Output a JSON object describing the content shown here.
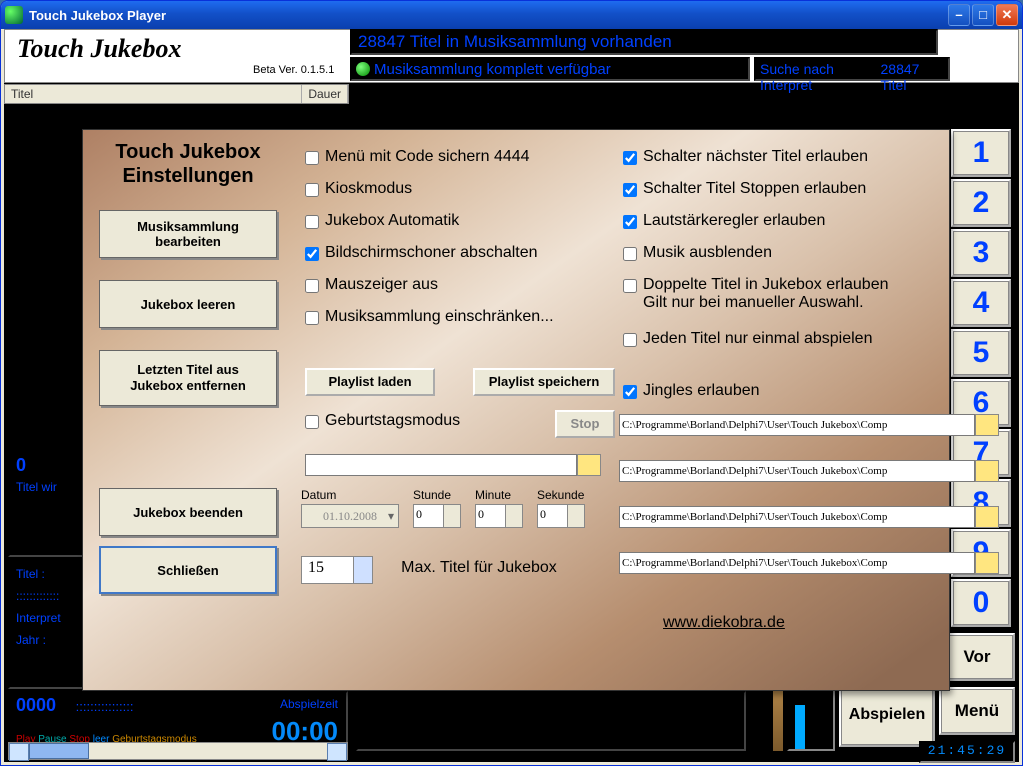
{
  "window": {
    "title": "Touch Jukebox Player"
  },
  "header": {
    "app_title": "Touch Jukebox",
    "beta": "Beta Ver. 0.1.5.1",
    "status": "28847 Titel in Musiksammlung vorhanden",
    "avail": "Musiksammlung komplett verfügbar",
    "search_label": "Suche nach Interpret",
    "search_count": "28847 Titel"
  },
  "list_header": {
    "titel": "Titel",
    "dauer": "Dauer"
  },
  "left_panels": {
    "count": "0",
    "queue": "Titel wir",
    "titel_label": "Titel :",
    "titel_dots": ":::::::::::::",
    "interpret_label": "Interpret",
    "jahr_label": "Jahr :",
    "year": "0000",
    "dots2": "::::::::::::::::",
    "play_label": "Abspielzeit",
    "play_time": "00:00",
    "tags": {
      "play": "Play",
      "pause": "Pause",
      "stop": "Stop",
      "leer": "leer",
      "gm": "Geburtstagsmodus"
    }
  },
  "keypad": [
    "1",
    "2",
    "3",
    "4",
    "5",
    "6",
    "7",
    "8",
    "9",
    "0"
  ],
  "side": {
    "vor": "Vor",
    "menu": "Menü",
    "abspielen": "Abspielen"
  },
  "clock": "21:45:29",
  "dialog": {
    "title_l1": "Touch Jukebox",
    "title_l2": "Einstellungen",
    "buttons": {
      "edit_collection": "Musiksammlung bearbeiten",
      "clear_jukebox": "Jukebox leeren",
      "remove_last_l1": "Letzten Titel aus",
      "remove_last_l2": "Jukebox entfernen",
      "quit": "Jukebox beenden",
      "close": "Schließen",
      "playlist_load": "Playlist laden",
      "playlist_save": "Playlist speichern",
      "stop": "Stop"
    },
    "checks_left": [
      {
        "label": "Menü mit Code sichern 4444",
        "checked": false
      },
      {
        "label": "Kioskmodus",
        "checked": false
      },
      {
        "label": "Jukebox Automatik",
        "checked": false
      },
      {
        "label": "Bildschirmschoner abschalten",
        "checked": true
      },
      {
        "label": "Mauszeiger aus",
        "checked": false
      },
      {
        "label": "Musiksammlung einschränken...",
        "checked": false
      }
    ],
    "checks_right": [
      {
        "label": "Schalter nächster Titel erlauben",
        "checked": true
      },
      {
        "label": "Schalter Titel Stoppen erlauben",
        "checked": true
      },
      {
        "label": "Lautstärkeregler erlauben",
        "checked": true
      },
      {
        "label": "Musik ausblenden",
        "checked": false
      },
      {
        "label": "Doppelte Titel in Jukebox erlauben\nGilt nur bei manueller Auswahl.",
        "checked": false
      },
      {
        "label": "Jeden Titel nur einmal abspielen",
        "checked": false
      }
    ],
    "birthday_label": "Geburtstagsmodus",
    "jingles_label": "Jingles erlauben",
    "jingles_checked": true,
    "jingle_paths": [
      "C:\\Programme\\Borland\\Delphi7\\User\\Touch Jukebox\\Comp",
      "C:\\Programme\\Borland\\Delphi7\\User\\Touch Jukebox\\Comp",
      "C:\\Programme\\Borland\\Delphi7\\User\\Touch Jukebox\\Comp",
      "C:\\Programme\\Borland\\Delphi7\\User\\Touch Jukebox\\Comp"
    ],
    "datetime": {
      "datum_label": "Datum",
      "stunde_label": "Stunde",
      "minute_label": "Minute",
      "sekunde_label": "Sekunde",
      "datum": "01.10.2008",
      "stunde": "0",
      "minute": "0",
      "sekunde": "0"
    },
    "max_titles": {
      "value": "15",
      "label": "Max. Titel für Jukebox"
    },
    "site": "www.diekobra.de"
  }
}
